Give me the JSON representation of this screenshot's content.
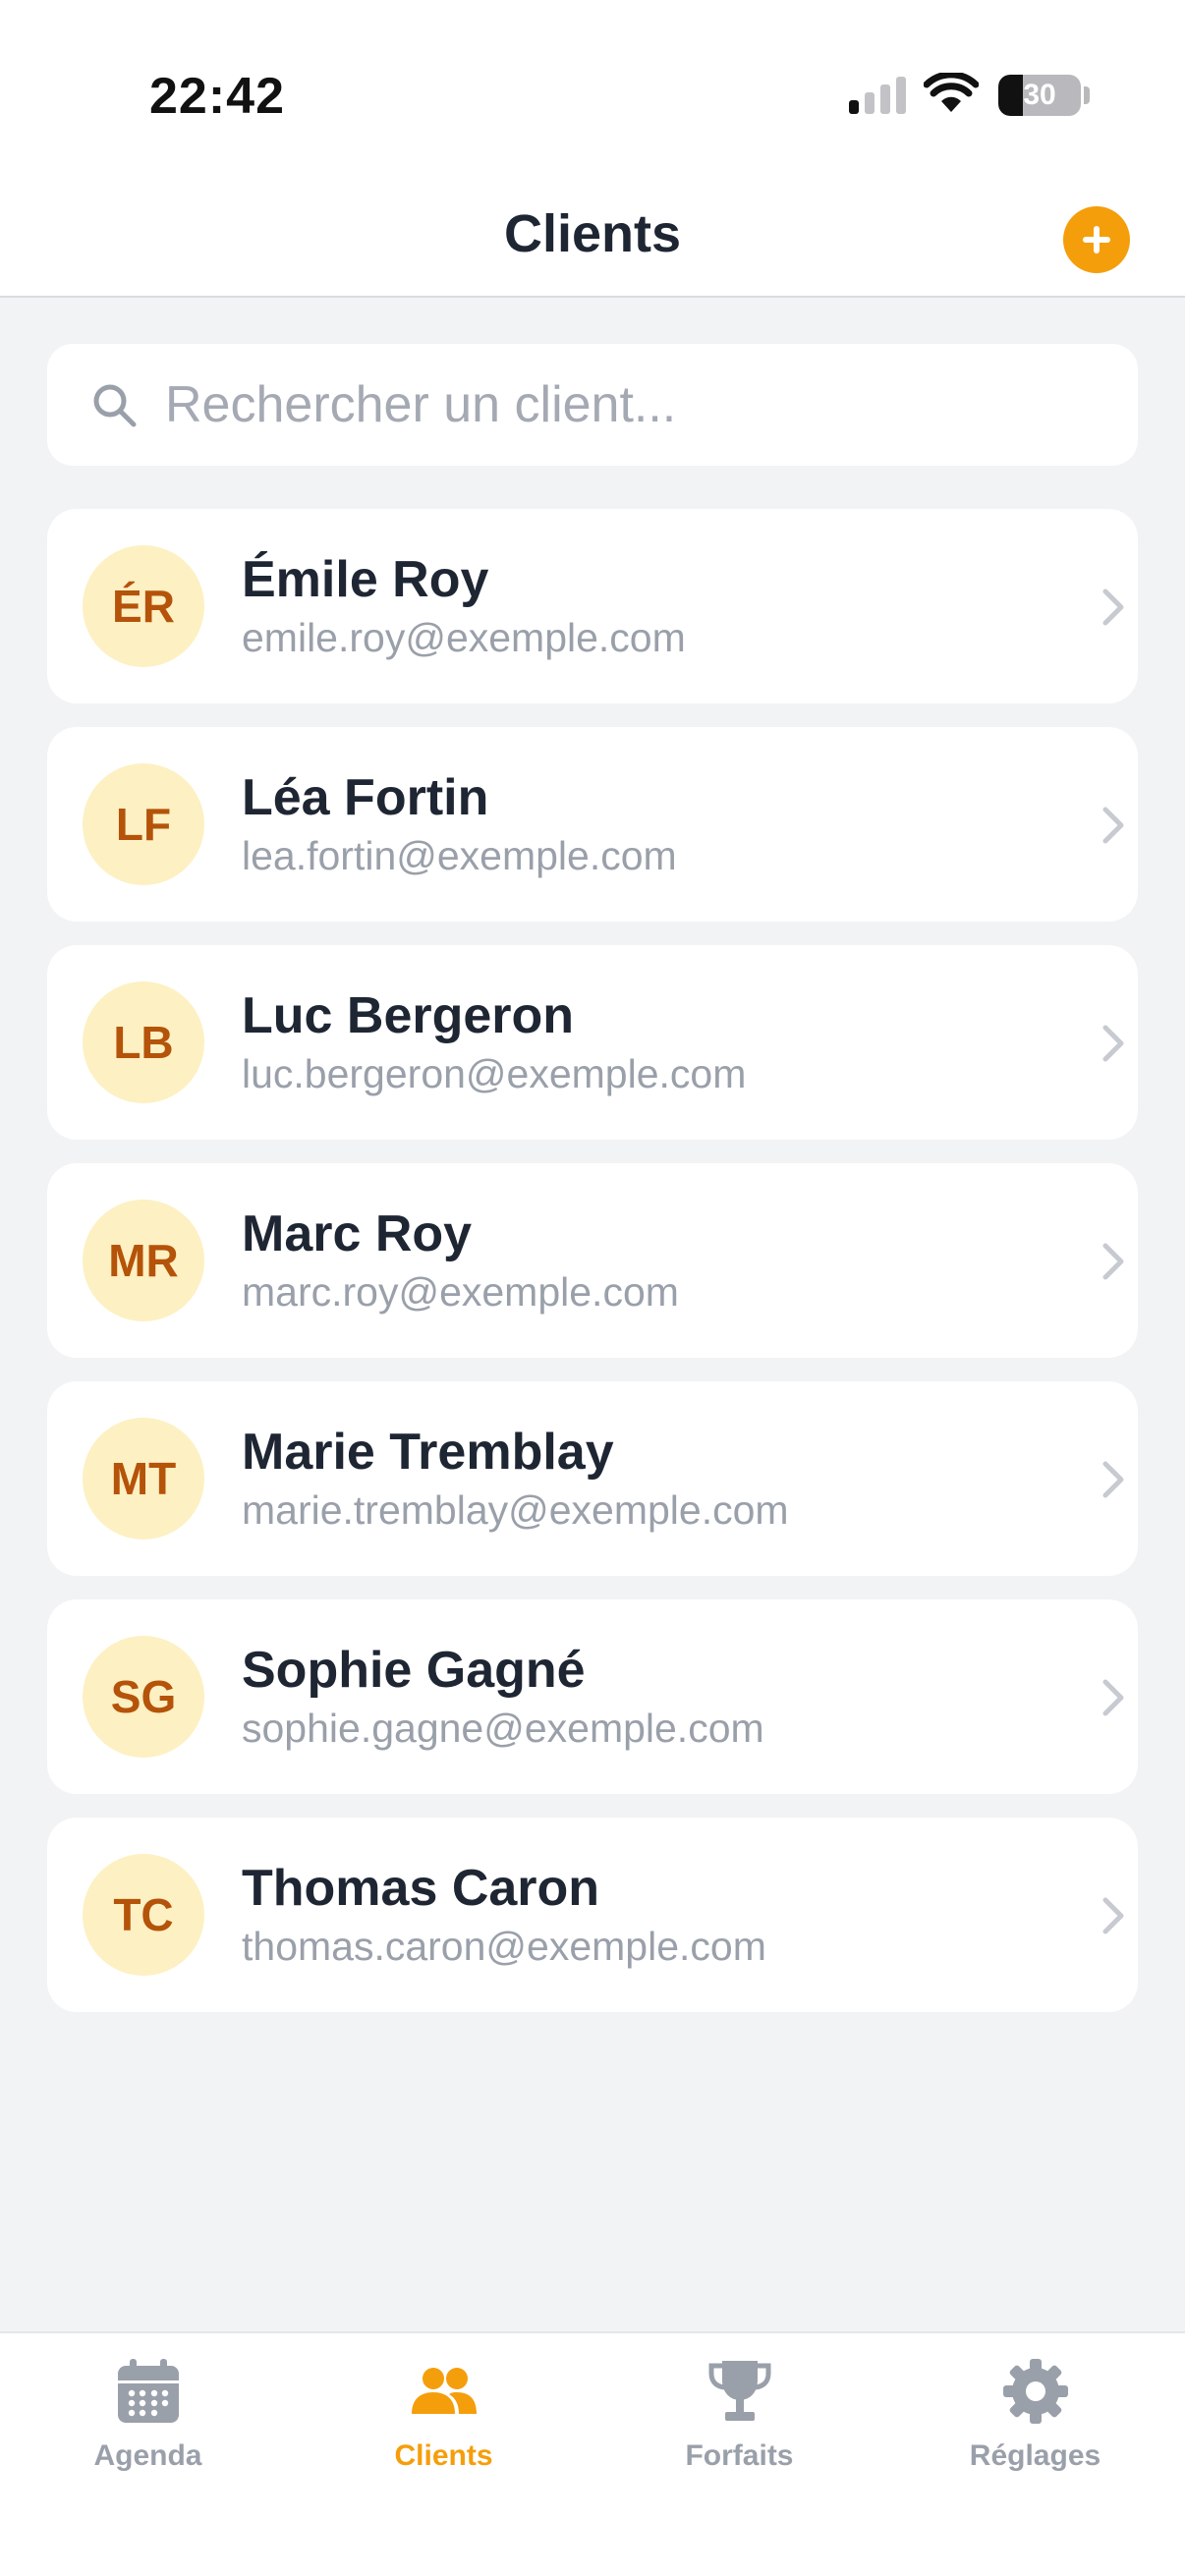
{
  "status_bar": {
    "time": "22:42",
    "battery": "30",
    "battery_level": 0.3
  },
  "header": {
    "title": "Clients",
    "add_icon": "plus-circle-icon"
  },
  "search": {
    "placeholder": "Rechercher un client...",
    "value": "",
    "icon": "search-icon"
  },
  "clients": [
    {
      "initials": "ÉR",
      "name": "Émile Roy",
      "email": "emile.roy@exemple.com"
    },
    {
      "initials": "LF",
      "name": "Léa Fortin",
      "email": "lea.fortin@exemple.com"
    },
    {
      "initials": "LB",
      "name": "Luc Bergeron",
      "email": "luc.bergeron@exemple.com"
    },
    {
      "initials": "MR",
      "name": "Marc Roy",
      "email": "marc.roy@exemple.com"
    },
    {
      "initials": "MT",
      "name": "Marie Tremblay",
      "email": "marie.tremblay@exemple.com"
    },
    {
      "initials": "SG",
      "name": "Sophie Gagné",
      "email": "sophie.gagne@exemple.com"
    },
    {
      "initials": "TC",
      "name": "Thomas Caron",
      "email": "thomas.caron@exemple.com"
    }
  ],
  "tabs": [
    {
      "label": "Agenda",
      "icon": "calendar-icon",
      "active": false
    },
    {
      "label": "Clients",
      "icon": "users-icon",
      "active": true
    },
    {
      "label": "Forfaits",
      "icon": "trophy-icon",
      "active": false
    },
    {
      "label": "Réglages",
      "icon": "gear-icon",
      "active": false
    }
  ],
  "colors": {
    "accent": "#f59e0b",
    "avatar_bg": "#fdf0c2",
    "avatar_text": "#b45309",
    "background": "#f2f3f5",
    "text_primary": "#1f2633",
    "text_secondary": "#9aa0aa"
  }
}
